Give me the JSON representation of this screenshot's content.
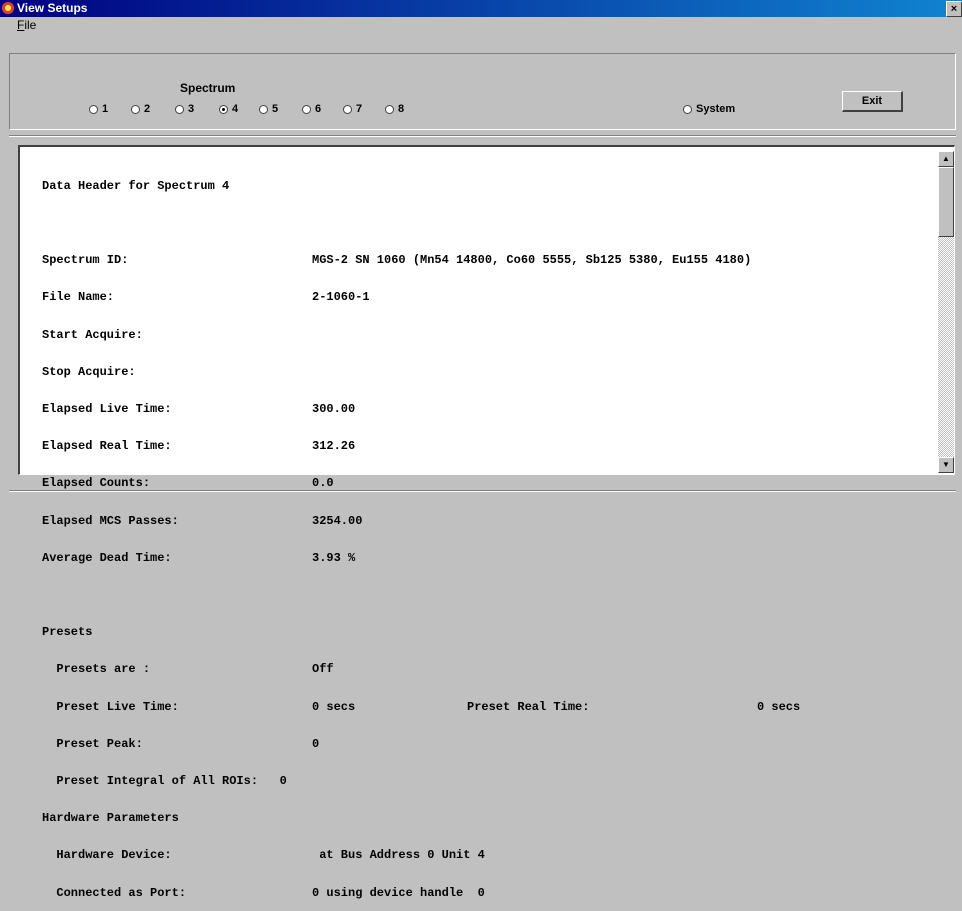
{
  "window": {
    "title": "View Setups",
    "close_glyph": "×"
  },
  "menu": {
    "file_accel": "F",
    "file_rest": "ile"
  },
  "controls": {
    "spectrum_label": "Spectrum",
    "radios": [
      "1",
      "2",
      "3",
      "4",
      "5",
      "6",
      "7",
      "8"
    ],
    "selected": "4",
    "system_label": "System",
    "exit_label": "Exit"
  },
  "header_text": {
    "title": "Data Header for Spectrum 4",
    "rows": [
      [
        "Spectrum ID:",
        "MGS-2 SN 1060 (Mn54 14800, Co60 5555, Sb125 5380, Eu155 4180)"
      ],
      [
        "File Name:",
        "2-1060-1"
      ],
      [
        "Start Acquire:",
        ""
      ],
      [
        "Stop Acquire:",
        ""
      ],
      [
        "Elapsed Live Time:",
        "300.00"
      ],
      [
        "Elapsed Real Time:",
        "312.26"
      ],
      [
        "Elapsed Counts:",
        "0.0"
      ],
      [
        "Elapsed MCS Passes:",
        "3254.00"
      ],
      [
        "Average Dead Time:",
        "3.93 %"
      ]
    ],
    "presets_heading": "Presets",
    "presets_are_label": "  Presets are :",
    "presets_are_value": "Off",
    "preset_live_label": "  Preset Live Time:",
    "preset_live_value": "0 secs",
    "preset_real_label": "Preset Real Time:",
    "preset_real_value": "0 secs",
    "preset_peak_label": "  Preset Peak:",
    "preset_peak_value": "0",
    "preset_integral_label": "  Preset Integral of All ROIs:   0",
    "hardware_heading": "Hardware Parameters",
    "hw_device_label": "  Hardware Device:",
    "hw_device_value": " at Bus Address 0 Unit 4",
    "hw_port_label": "  Connected as Port:",
    "hw_port_value": "0 using device handle  0"
  }
}
